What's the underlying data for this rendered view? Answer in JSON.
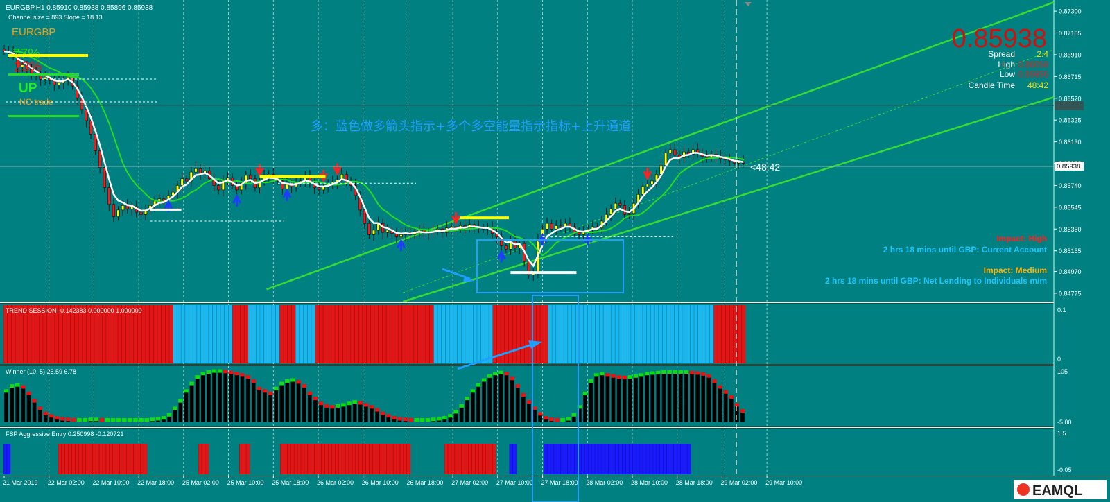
{
  "header": {
    "symbol_line": "EURGBP,H1  0.85910 0.85938 0.85896 0.85938",
    "channel_line": "Channel size = 893 Slope = 18.13"
  },
  "overlay": {
    "pair": "EURGBP",
    "pct_up": "77%",
    "pct_down": "23%",
    "trend": "UP",
    "trade": "NO trade",
    "annotation": "多：蓝色做多箭头指示+多个多空能量指示指标+上升通道",
    "timer": "<48:42"
  },
  "info_panel": {
    "price": "0.85938",
    "spread_label": "Spread",
    "spread_value": "2.4",
    "high_label": "High",
    "high_value": "0.86058",
    "low_label": "Low",
    "low_value": "0.85855",
    "candle_label": "Candle Time",
    "candle_value": "48:42"
  },
  "news": [
    {
      "impact": "Impact: High",
      "text": "2 hrs 18 mins until GBP: Current Account",
      "impact_color": "#ff2020"
    },
    {
      "impact": "Impact: Medium",
      "text": "2 hrs 18 mins until GBP: Net Lending to Individuals m/m",
      "impact_color": "#ffb000"
    }
  ],
  "price_axis": {
    "ticks": [
      "0.87300",
      "0.87105",
      "0.86910",
      "0.86715",
      "0.86520",
      "0.86325",
      "0.86130",
      "0.85938",
      "0.85740",
      "0.85545",
      "0.85350",
      "0.85155",
      "0.84970",
      "0.84775"
    ],
    "current": "0.85938"
  },
  "time_axis": {
    "labels": [
      "21 Mar 2019",
      "22 Mar 02:00",
      "22 Mar 10:00",
      "22 Mar 18:00",
      "25 Mar 02:00",
      "25 Mar 10:00",
      "25 Mar 18:00",
      "26 Mar 02:00",
      "26 Mar 10:00",
      "26 Mar 18:00",
      "27 Mar 02:00",
      "27 Mar 10:00",
      "27 Mar 18:00",
      "28 Mar 02:00",
      "28 Mar 10:00",
      "28 Mar 18:00",
      "29 Mar 02:00",
      "29 Mar 10:00"
    ]
  },
  "sub_panels": {
    "trend_title": "TREND SESSION -0.142383 0.000000 1.000000",
    "trend_axis_top": "0.1",
    "trend_axis_bottom": "0",
    "winner_title": "Winner (10, 5)  25.59 6.78",
    "winner_axis_top": "105",
    "winner_axis_bottom": "-5.00",
    "fsp_title": "FSP Aggressive Entry 0.250998 -0.120721",
    "fsp_axis_top": "1.5",
    "fsp_axis_bottom": "-0.05"
  },
  "watermark": "EAMQL",
  "colors": {
    "background": "#008080",
    "up": "#ffff00",
    "down": "#ff1a1a",
    "ma_white": "#ffffff",
    "ma_green": "#22dd22",
    "channel": "#33dd33",
    "trend_red": "#e21616",
    "trend_blue": "#1ab8ef",
    "fsp_red": "#e21616",
    "fsp_blue": "#1a1aff",
    "annotation": "#1e9fff"
  },
  "chart_data": [
    {
      "type": "candlestick",
      "title": "EURGBP,H1",
      "x_labels": [
        "21 Mar 2019",
        "22 Mar 02:00",
        "22 Mar 10:00",
        "22 Mar 18:00",
        "25 Mar 02:00",
        "25 Mar 10:00",
        "25 Mar 18:00",
        "26 Mar 02:00",
        "26 Mar 10:00",
        "26 Mar 18:00",
        "27 Mar 02:00",
        "27 Mar 10:00",
        "27 Mar 18:00",
        "28 Mar 02:00",
        "28 Mar 10:00",
        "28 Mar 18:00",
        "29 Mar 02:00",
        "29 Mar 10:00"
      ],
      "ylim": [
        0.847,
        0.874
      ],
      "close": [
        0.8694,
        0.8693,
        0.869,
        0.868,
        0.8682,
        0.8678,
        0.8674,
        0.8672,
        0.8669,
        0.8671,
        0.8668,
        0.8664,
        0.8666,
        0.8668,
        0.8671,
        0.8663,
        0.8652,
        0.8642,
        0.8632,
        0.862,
        0.8605,
        0.859,
        0.8572,
        0.8557,
        0.8546,
        0.8552,
        0.8556,
        0.8553,
        0.8555,
        0.855,
        0.8548,
        0.8552,
        0.8556,
        0.856,
        0.8562,
        0.856,
        0.8565,
        0.8568,
        0.8574,
        0.858,
        0.8578,
        0.8586,
        0.8589,
        0.8585,
        0.8587,
        0.858,
        0.8574,
        0.857,
        0.8579,
        0.8581,
        0.8574,
        0.857,
        0.8576,
        0.8583,
        0.858,
        0.8572,
        0.8578,
        0.8582,
        0.8584,
        0.858,
        0.8578,
        0.8571,
        0.8575,
        0.8573,
        0.8576,
        0.8578,
        0.8582,
        0.8576,
        0.8572,
        0.857,
        0.8573,
        0.8575,
        0.8577,
        0.8579,
        0.8584,
        0.8577,
        0.8574,
        0.8565,
        0.8552,
        0.854,
        0.853,
        0.8534,
        0.854,
        0.8532,
        0.8534,
        0.8531,
        0.8528,
        0.853,
        0.8532,
        0.853,
        0.8533,
        0.8534,
        0.8531,
        0.8532,
        0.8533,
        0.8535,
        0.8532,
        0.8536,
        0.8537,
        0.8535,
        0.8538,
        0.8536,
        0.8539,
        0.8537,
        0.8536,
        0.8535,
        0.8536,
        0.8531,
        0.8528,
        0.852,
        0.8517,
        0.8524,
        0.8518,
        0.8522,
        0.8506,
        0.8494,
        0.8495,
        0.8525,
        0.8535,
        0.854,
        0.8535,
        0.8538,
        0.8537,
        0.854,
        0.8537,
        0.8532,
        0.853,
        0.8532,
        0.8535,
        0.8537,
        0.8536,
        0.8542,
        0.8548,
        0.8553,
        0.8558,
        0.8556,
        0.8548,
        0.8549,
        0.8558,
        0.8566,
        0.8573,
        0.8575,
        0.8578,
        0.8584,
        0.8592,
        0.8603,
        0.8606,
        0.8601,
        0.8599,
        0.8604,
        0.8602,
        0.8606,
        0.8603,
        0.86,
        0.8599,
        0.8602,
        0.86,
        0.8598,
        0.8597,
        0.8596,
        0.8594,
        0.8595,
        0.8594
      ],
      "series": [
        {
          "name": "channel upper",
          "x": [
            0.25,
            1.0
          ],
          "y": [
            0.8481,
            0.8738
          ]
        },
        {
          "name": "channel lower",
          "x": [
            0.38,
            1.0
          ],
          "y": [
            0.847,
            0.8653
          ]
        }
      ]
    },
    {
      "type": "bar",
      "title": "TREND SESSION",
      "ylim": [
        0,
        0.1
      ],
      "segments_red_blue": "RRRRRRRRRRRRRRRRRRRRRRRRRRRRRRRRRRRRRRRRRRRBBBBBBBBBBBBBBBRRRRBBBBBBBBRRRRBBBBBRRRRRRRRRRRRRRRRRRRRRRRRRRRRRRBBBBBBBBBBBBBBBRRRRRRRRRRRRRRBBBBBBBBBBBBBBBBBBBBBBBBBBBBBBBBBBBBBBBBBBRRRRRRRR"
    },
    {
      "type": "bar",
      "title": "Winner (10, 5)",
      "ylim": [
        -5,
        105
      ],
      "values": [
        60,
        70,
        72,
        68,
        55,
        40,
        25,
        15,
        10,
        6,
        4,
        3,
        2,
        2,
        2,
        3,
        3,
        2,
        2,
        2,
        2,
        2,
        2,
        2,
        2,
        2,
        3,
        4,
        6,
        12,
        25,
        40,
        60,
        75,
        88,
        95,
        98,
        100,
        100,
        99,
        97,
        95,
        92,
        88,
        80,
        65,
        60,
        55,
        65,
        75,
        80,
        82,
        78,
        70,
        55,
        45,
        35,
        30,
        28,
        30,
        32,
        35,
        38,
        36,
        32,
        28,
        22,
        15,
        10,
        6,
        4,
        3,
        2,
        2,
        2,
        2,
        3,
        4,
        6,
        10,
        18,
        30,
        45,
        60,
        72,
        82,
        90,
        95,
        97,
        95,
        85,
        70,
        52,
        38,
        25,
        14,
        6,
        3,
        2,
        2,
        4,
        12,
        28,
        55,
        80,
        92,
        95,
        92,
        90,
        88,
        87,
        88,
        90,
        92,
        95,
        96,
        97,
        98,
        98,
        98,
        98,
        98,
        97,
        96,
        94,
        90,
        80,
        68,
        58,
        48,
        32,
        20
      ],
      "colors_rule": "green while rising, red while falling, black body"
    },
    {
      "type": "bar",
      "title": "FSP Aggressive Entry",
      "ylim": [
        -0.05,
        1.5
      ],
      "segments_red_blue_empty": "BB______________RRRRRRRRRRRRRRRRRRRRRRRRRR_______________RRR_________RRR_________RRRRRRRRRRRRRRRRRRRRRRRRRRRRRRRRRRRRRR__________RRRRRRRRRRRRRRR____BB________BBBBBBBBBBBBBBBBBBBBBBBBBBBBBBBBBBBBBBBBBBB________________"
    }
  ]
}
